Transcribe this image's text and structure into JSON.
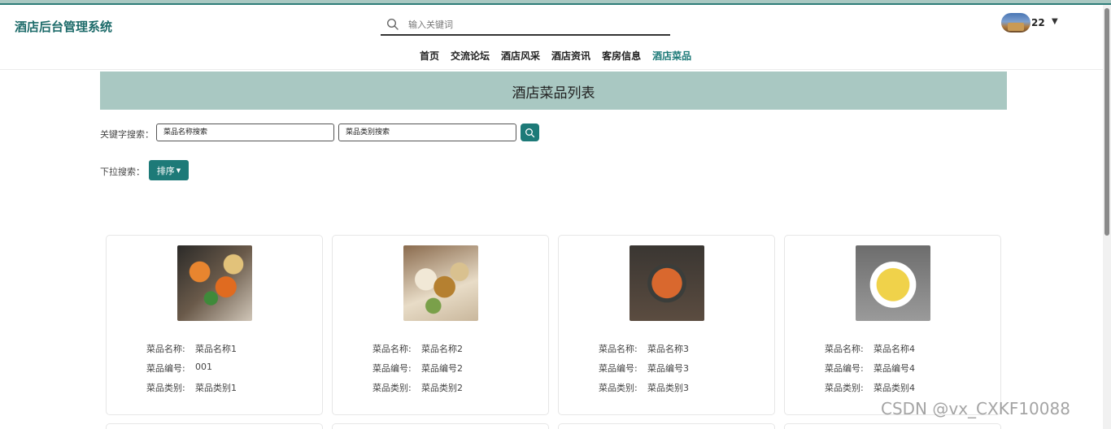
{
  "header": {
    "brand": "酒店后台管理系统",
    "search_placeholder": "输入关键词",
    "username": "22"
  },
  "nav": {
    "items": [
      {
        "label": "首页"
      },
      {
        "label": "交流论坛"
      },
      {
        "label": "酒店风采"
      },
      {
        "label": "酒店资讯"
      },
      {
        "label": "客房信息"
      },
      {
        "label": "酒店菜品",
        "active": true
      }
    ]
  },
  "banner": {
    "title": "酒店菜品列表"
  },
  "filters": {
    "keyword_label": "关键字搜索：",
    "name_placeholder": "菜品名称搜索",
    "category_placeholder": "菜品类别搜索",
    "dropdown_label": "下拉搜索：",
    "sort_label": "排序"
  },
  "cards": [
    {
      "name_label": "菜品名称:",
      "name": "菜品名称1",
      "code_label": "菜品编号:",
      "code": "001",
      "category_label": "菜品类别:",
      "category": "菜品类别1"
    },
    {
      "name_label": "菜品名称:",
      "name": "菜品名称2",
      "code_label": "菜品编号:",
      "code": "菜品编号2",
      "category_label": "菜品类别:",
      "category": "菜品类别2"
    },
    {
      "name_label": "菜品名称:",
      "name": "菜品名称3",
      "code_label": "菜品编号:",
      "code": "菜品编号3",
      "category_label": "菜品类别:",
      "category": "菜品类别3"
    },
    {
      "name_label": "菜品名称:",
      "name": "菜品名称4",
      "code_label": "菜品编号:",
      "code": "菜品编号4",
      "category_label": "菜品类别:",
      "category": "菜品类别4"
    }
  ],
  "watermark": "CSDN @vx_CXKF10088",
  "colors": {
    "accent": "#1d7a78",
    "banner_bg": "#a9c8c2"
  }
}
